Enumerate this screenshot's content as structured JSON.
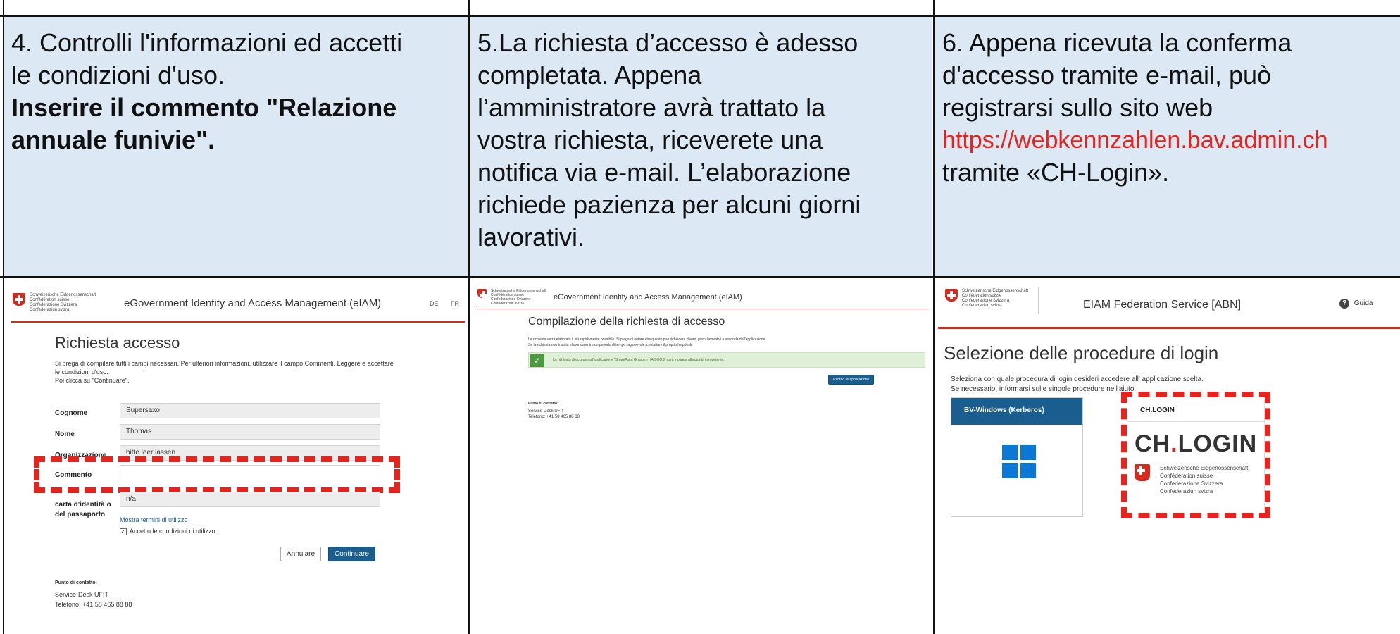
{
  "steps": [
    {
      "lines": [
        "4. Controlli l'informazioni ed accetti",
        "le condizioni d'uso."
      ],
      "bold_lines": [
        "Inserire il commento \"Relazione",
        "annuale funivie\"."
      ]
    },
    {
      "lines": [
        "5.La richiesta d’accesso è adesso",
        "completata. Appena",
        "l’amministratore avrà trattato la",
        "vostra richiesta, riceverete una",
        "notifica via e-mail. L’elaborazione",
        "richiede pazienza per alcuni giorni",
        "lavorativi."
      ]
    },
    {
      "lines": [
        "6. Appena ricevuta la conferma",
        "d'accesso tramite e-mail, può",
        "registrarsi sullo sito web"
      ],
      "link": "https://webkennzahlen.bav.admin.ch",
      "after": "tramite «CH-Login»."
    }
  ],
  "confed_lines": [
    "Schweizerische Eidgenossenschaft",
    "Confédération suisse",
    "Confederazione Svizzera",
    "Confederaziun svizra"
  ],
  "shot1": {
    "app_title": "eGovernment Identity and Access Management (eIAM)",
    "lang_de": "DE",
    "lang_fr": "FR",
    "heading": "Richiesta accesso",
    "intro_1": "Si prega di compilare tutti i campi necessari. Per ulteriori informazioni, utilizzare il campo Commenti. Leggere e accettare",
    "intro_2": "le condizioni d'uso.",
    "intro_3": "Poi clicca su \"Continuare\".",
    "fields": [
      {
        "label": "Cognome",
        "value": "Supersaxo"
      },
      {
        "label": "Nome",
        "value": "Thomas"
      },
      {
        "label": "Organizzazione",
        "value": "bitte leer lassen"
      },
      {
        "label": "Commento",
        "value": ""
      }
    ],
    "id_label_1": "carta d'identità o",
    "id_label_2": "del passaporto",
    "id_value": "n/a",
    "terms_link": "Mostra termini di utilizzo",
    "accept": "Accetto le condizioni di utilizzo.",
    "cancel": "Annulare",
    "continue": "Continuare",
    "contact_title": "Punto di contatto:",
    "contact_1": "Service-Desk UFIT",
    "contact_2": "Telefono: +41 58 465 88 88"
  },
  "shot2": {
    "app_title": "eGovernment Identity and Access Management (eIAM)",
    "heading": "Compilazione della richiesta di accesso",
    "info_1": "La richiesta verrà elaborata il più rapidamente possibile. Si prega di notare che questo può richiedere diversi giorni lavorativi a seconda dell'applicazione.",
    "info_2": "Se la richiesta non è stata elaborata entro un periodo di tempo ragionevole, contattare il proprio helpdesk.",
    "success": "La richiesta di accesso all'applicazione \"SharePoint Gruppen HAIBOOS\" sarà inoltrata all'autorità competente.",
    "back_btn": "Ritorno all'applicazione",
    "contact_title": "Punto di contatto:",
    "contact_1": "Service-Desk UFIT",
    "contact_2": "Telefono: +41 58 465 88 88"
  },
  "shot3": {
    "app_title": "EIAM Federation Service [ABN]",
    "help": "Guida",
    "heading": "Selezione delle procedure di login",
    "desc_1": "Seleziona con quale procedura di login desideri accedere all' applicazione scelta.",
    "desc_2": "Se necessario, informarsi sulle singole procedure nell'aiuto.",
    "card1_title": "BV-Windows (Kerberos)",
    "card2_title": "CH.LOGIN",
    "chlogin_a": "CH",
    "chlogin_dot": ".",
    "chlogin_b": "LOGIN"
  }
}
